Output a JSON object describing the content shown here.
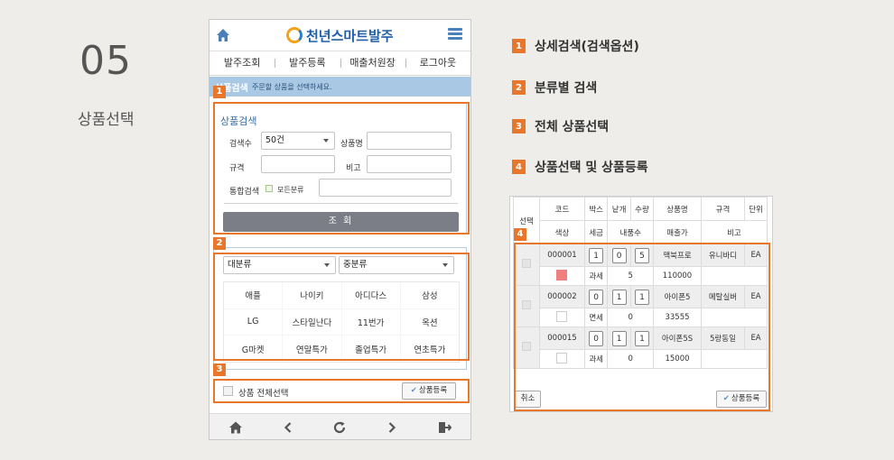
{
  "step": {
    "number": "05",
    "title": "상품선택"
  },
  "app": {
    "brand": "천년스마트발주",
    "nav": [
      "발주조회",
      "발주등록",
      "매출처원장",
      "로그아웃"
    ],
    "subbar": {
      "title": "상품검색",
      "hint": "주문할 상품을 선택하세요."
    },
    "search": {
      "panel_title": "상품검색",
      "count_label": "검색수",
      "count_value": "50건",
      "name_label": "상품명",
      "spec_label": "규격",
      "note_label": "비고",
      "combined_label": "통합검색",
      "all_category_label": "모든분류",
      "search_button": "조 회"
    },
    "category": {
      "major": "대분류",
      "middle": "중분류",
      "brands": [
        "애플",
        "나이키",
        "아디다스",
        "삼성",
        "LG",
        "스타일난다",
        "11번가",
        "옥션",
        "G마켓",
        "연말특가",
        "졸업특가",
        "연초특가"
      ]
    },
    "bottom": {
      "select_all": "상품 전체선택",
      "register": "상품등록"
    }
  },
  "legend": [
    {
      "num": "1",
      "text": "상세검색(검색옵션)"
    },
    {
      "num": "2",
      "text": "분류별 검색"
    },
    {
      "num": "3",
      "text": "전체 상품선택"
    },
    {
      "num": "4",
      "text": "상품선택 및 상품등록"
    }
  ],
  "callouts": [
    "1",
    "2",
    "3",
    "4"
  ],
  "product_table": {
    "headers_top": [
      "코드",
      "박스",
      "낱개",
      "수량",
      "상품명",
      "규격",
      "단위"
    ],
    "select_header": "선택",
    "headers_bottom": [
      "색상",
      "세금",
      "내품수",
      "매출가",
      "비고"
    ],
    "rows": [
      {
        "code": "000001",
        "box": "1",
        "each": "0",
        "qty": "5",
        "name": "맥북프로",
        "spec": "유니바디",
        "unit": "EA",
        "tax": "과세",
        "inner": "5",
        "price": "110000",
        "color": "#f08080"
      },
      {
        "code": "000002",
        "box": "0",
        "each": "1",
        "qty": "1",
        "name": "아이폰5",
        "spec": "메탈실버",
        "unit": "EA",
        "tax": "면세",
        "inner": "0",
        "price": "33555",
        "color": "#ffffff"
      },
      {
        "code": "000015",
        "box": "0",
        "each": "1",
        "qty": "1",
        "name": "아이폰5S",
        "spec": "5랑동일",
        "unit": "EA",
        "tax": "과세",
        "inner": "0",
        "price": "15000",
        "color": "#ffffff"
      }
    ],
    "cancel": "취소",
    "register": "상품등록"
  },
  "colors": {
    "accent": "#e8772c",
    "brand": "#1f5ea8",
    "subbar": "#a9c8e4"
  }
}
